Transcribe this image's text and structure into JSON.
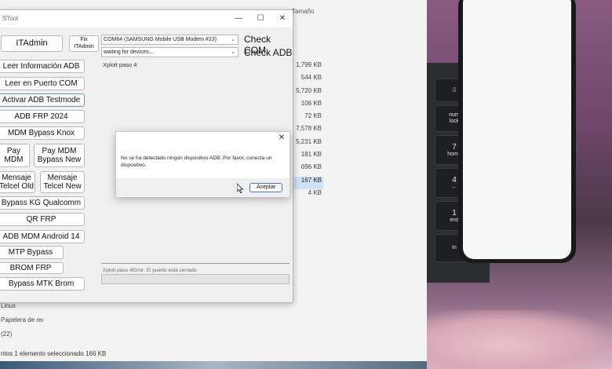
{
  "explorer": {
    "column_header": "Tamaño",
    "sizes": [
      "1,799 KB",
      "544 KB",
      "5,720 KB",
      "106 KB",
      "72 KB",
      "7,578 KB",
      "5,231 KB",
      "181 KB",
      "696 KB",
      "167 KB",
      "4 KB"
    ],
    "selected_size_index": 9,
    "nav_items": [
      "Linux",
      "Papelera de reci",
      "(22)"
    ],
    "status_items": "ntos    1 elemento seleccionado  166 KB"
  },
  "tool": {
    "title": "STool",
    "buttons": {
      "itadmin": "ITAdmin",
      "fix_itadmin": "Fix ITAdmin",
      "leer_info_adb": "Leer Información ADB",
      "leer_puerto_com": "Leer en Puerto COM",
      "activar_adb_testmode": "Activar ADB Testmode",
      "adb_frp_2024": "ADB FRP 2024",
      "mdm_bypass_knox": "MDM Bypass Knox",
      "pay_mdm": "Pay\nMDM",
      "pay_mdm_bypass_new": "Pay MDM\nBypass New",
      "mensaje_telcel_old": "Mensaje\nTelcel Old",
      "mensaje_telcel_new": "Mensaje\nTelcel New",
      "bypass_kg_qualcomm": "Bypass KG Qualcomm",
      "qr_frp": "QR FRP",
      "adb_mdm_android_14": "ADB MDM Android 14",
      "mtp_bypass": "MTP Bypass",
      "brom_frp": "BROM FRP",
      "bypass_mtk_brom": "Bypass MTK Brom"
    },
    "com_select": "COM64 (SAMSUNG Mobile USB Modem #23)",
    "adb_select": "waiting for devices...",
    "check_com": "Check COM",
    "check_adb": "Check ADB",
    "log_text": "Xploit paso 4",
    "status_text": "Xploit paso 4Error: El puerto está cerrado",
    "progress": 0
  },
  "dialog": {
    "message": "No se ha detectado ningún dispositivo ADB. Por favor, conecta un dispositivo.",
    "ok_label": "Aceptar"
  },
  "keyboard": {
    "keys": [
      {
        "top": "",
        "label": ""
      },
      {
        "top": "num",
        "label": "lock"
      },
      {
        "top": "7",
        "label": "home"
      },
      {
        "top": "4",
        "label": "←"
      },
      {
        "top": "1",
        "label": "end"
      },
      {
        "top": "",
        "label": "in"
      }
    ]
  }
}
